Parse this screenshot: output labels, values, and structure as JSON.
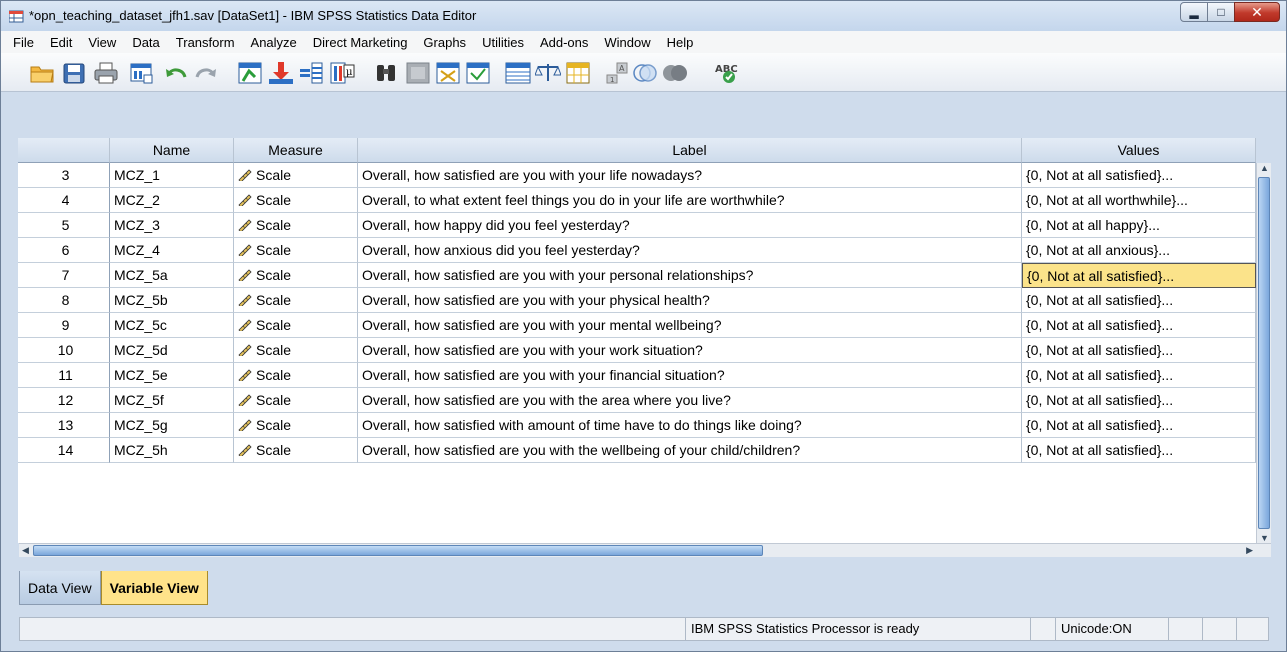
{
  "window": {
    "title": "*opn_teaching_dataset_jfh1.sav [DataSet1] - IBM SPSS Statistics Data Editor",
    "minimize_icon": "minimize-icon",
    "maximize_icon": "maximize-icon",
    "close_icon": "close-icon"
  },
  "menu": [
    "File",
    "Edit",
    "View",
    "Data",
    "Transform",
    "Analyze",
    "Direct Marketing",
    "Graphs",
    "Utilities",
    "Add-ons",
    "Window",
    "Help"
  ],
  "toolbar": {
    "icons": [
      "open-folder-icon",
      "save-icon",
      "print-icon",
      "dialog-recall-icon",
      "undo-icon",
      "redo-icon",
      "goto-case-icon",
      "goto-variable-icon",
      "variables-icon",
      "run-descriptives-icon",
      "find-icon",
      "insert-cases-icon",
      "insert-variable-icon",
      "split-file-icon",
      "weight-cases-icon",
      "select-cases-icon",
      "value-labels-icon",
      "use-variable-sets-icon",
      "show-all-variables-icon",
      "spell-check-icon"
    ]
  },
  "grid": {
    "columns": [
      "Name",
      "Measure",
      "Label",
      "Values"
    ],
    "rows": [
      {
        "num": "3",
        "name": "MCZ_1",
        "measure": "Scale",
        "label": "Overall, how satisfied are you with your life nowadays?",
        "values": "{0, Not at all satisfied}..."
      },
      {
        "num": "4",
        "name": "MCZ_2",
        "measure": "Scale",
        "label": "Overall, to what extent feel things you do in your life are worthwhile?",
        "values": "{0, Not at all worthwhile}..."
      },
      {
        "num": "5",
        "name": "MCZ_3",
        "measure": "Scale",
        "label": "Overall, how happy did you feel yesterday?",
        "values": "{0, Not at all happy}..."
      },
      {
        "num": "6",
        "name": "MCZ_4",
        "measure": "Scale",
        "label": "Overall, how anxious did you feel yesterday?",
        "values": "{0, Not at all anxious}..."
      },
      {
        "num": "7",
        "name": "MCZ_5a",
        "measure": "Scale",
        "label": "Overall, how satisfied are you with your personal relationships?",
        "values": "{0, Not at all satisfied}..."
      },
      {
        "num": "8",
        "name": "MCZ_5b",
        "measure": "Scale",
        "label": "Overall, how satisfied are you with your physical health?",
        "values": "{0, Not at all satisfied}..."
      },
      {
        "num": "9",
        "name": "MCZ_5c",
        "measure": "Scale",
        "label": "Overall, how satisfied are you with your mental wellbeing?",
        "values": "{0, Not at all satisfied}..."
      },
      {
        "num": "10",
        "name": "MCZ_5d",
        "measure": "Scale",
        "label": "Overall, how satisfied are you with your work situation?",
        "values": "{0, Not at all satisfied}..."
      },
      {
        "num": "11",
        "name": "MCZ_5e",
        "measure": "Scale",
        "label": "Overall, how satisfied are you with your financial situation?",
        "values": "{0, Not at all satisfied}..."
      },
      {
        "num": "12",
        "name": "MCZ_5f",
        "measure": "Scale",
        "label": "Overall, how satisfied are you with the area where you live?",
        "values": "{0, Not at all satisfied}..."
      },
      {
        "num": "13",
        "name": "MCZ_5g",
        "measure": "Scale",
        "label": "Overall, how satisfied with amount of time have to do things like doing?",
        "values": "{0, Not at all satisfied}..."
      },
      {
        "num": "14",
        "name": "MCZ_5h",
        "measure": "Scale",
        "label": "Overall, how satisfied are you with the wellbeing of your child/children?",
        "values": "{0, Not at all satisfied}..."
      }
    ],
    "selected_row": "7",
    "measure_icon": "ruler-icon"
  },
  "tabs": [
    "Data View",
    "Variable View"
  ],
  "active_tab": "Variable View",
  "status": {
    "processor": "IBM SPSS Statistics Processor is ready",
    "unicode": "Unicode:ON"
  },
  "colors": {
    "selected_cell": "#fbe38a",
    "active_tab": "#ffe38a",
    "header_bg": "#d6e3f3"
  }
}
